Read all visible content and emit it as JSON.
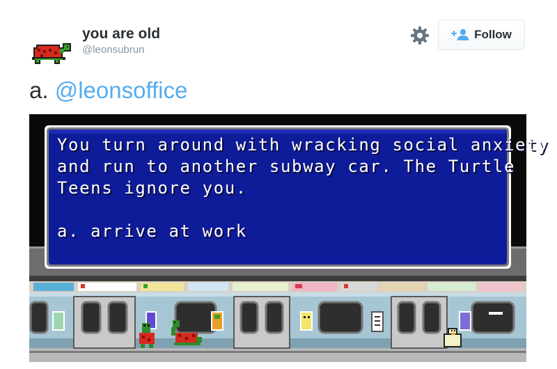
{
  "user": {
    "display_name": "you are old",
    "handle": "@leonsubrun"
  },
  "actions": {
    "follow_label": "Follow"
  },
  "tweet": {
    "prefix": "a. ",
    "mention": "@leonsoffice"
  },
  "game": {
    "dialog_lines": [
      "You turn around with wracking social anxiety",
      "and run to another subway car. The Turtle",
      "Teens ignore you."
    ],
    "choice": "a. arrive at work"
  },
  "icons": {
    "avatar": "pixel-turtle-icon",
    "settings": "gear-icon",
    "follow": "add-user-icon"
  },
  "colors": {
    "link": "#55acee",
    "dialog_blue": "#0e1c9a",
    "text_dark": "#292f33",
    "handle_gray": "#8899a6"
  }
}
